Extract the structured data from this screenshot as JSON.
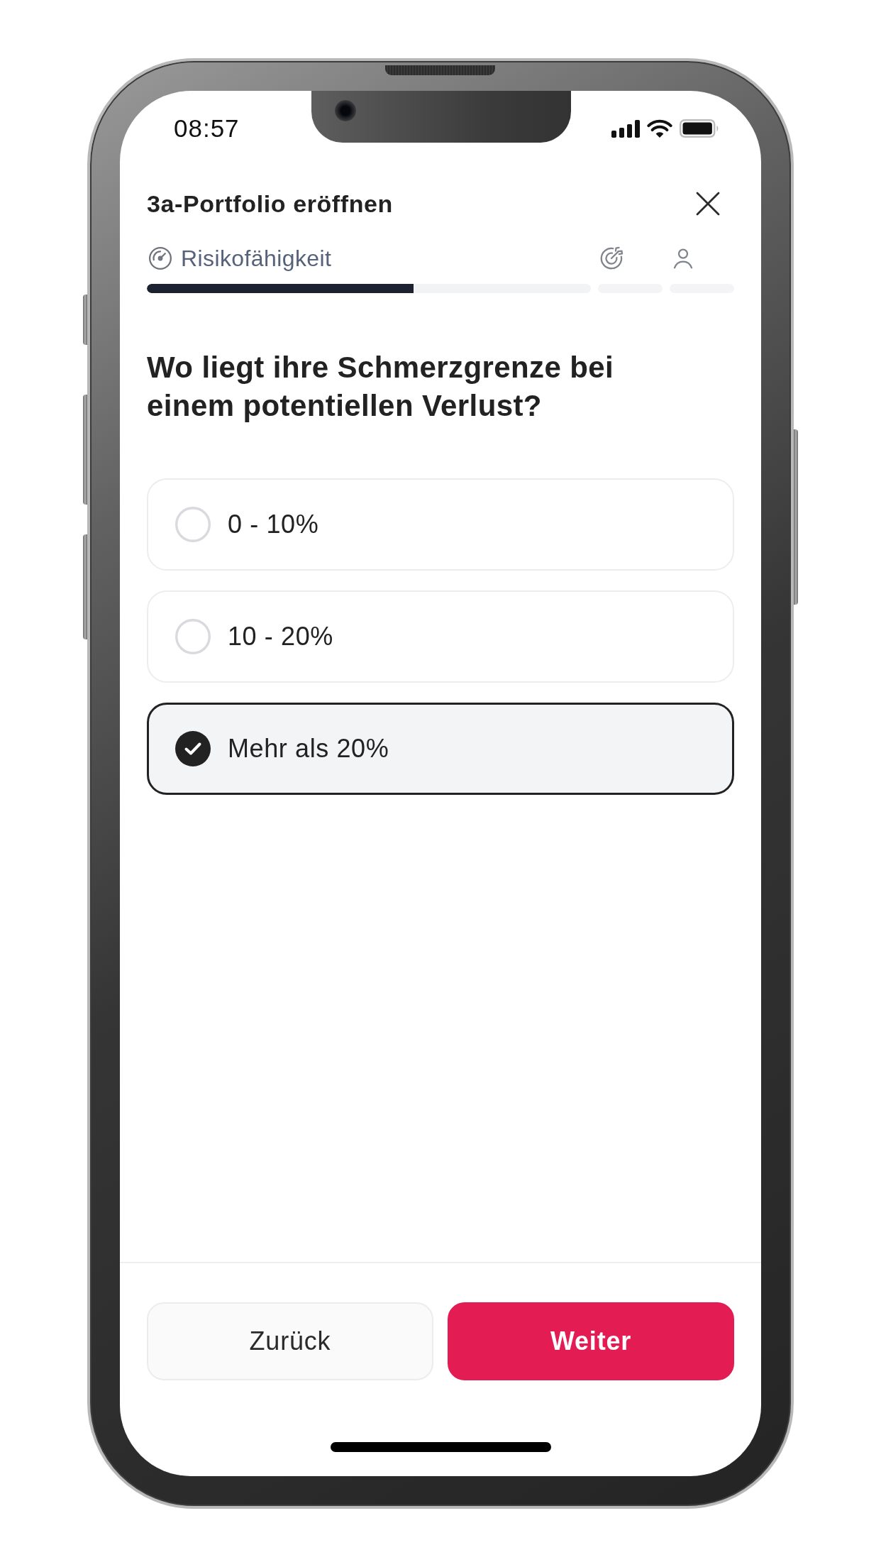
{
  "status_bar": {
    "time": "08:57"
  },
  "header": {
    "title": "3a-Portfolio eröffnen"
  },
  "steps": [
    {
      "kind": "gauge",
      "label": "Risikofähigkeit",
      "selected": true,
      "level": 0.6
    },
    {
      "kind": "target",
      "selected": false
    },
    {
      "kind": "person",
      "selected": false
    }
  ],
  "question": "Wo liegt ihre Schmerzgrenze bei einem potentiellen Verlust?",
  "options": [
    {
      "label": "0 - 10%",
      "selected": false
    },
    {
      "label": "10 - 20%",
      "selected": false
    },
    {
      "label": "Mehr als 20%",
      "selected": true
    }
  ],
  "buttons": [
    {
      "label": "Zurück",
      "kind": "secondary"
    },
    {
      "label": "Weiter",
      "kind": "primary"
    }
  ]
}
